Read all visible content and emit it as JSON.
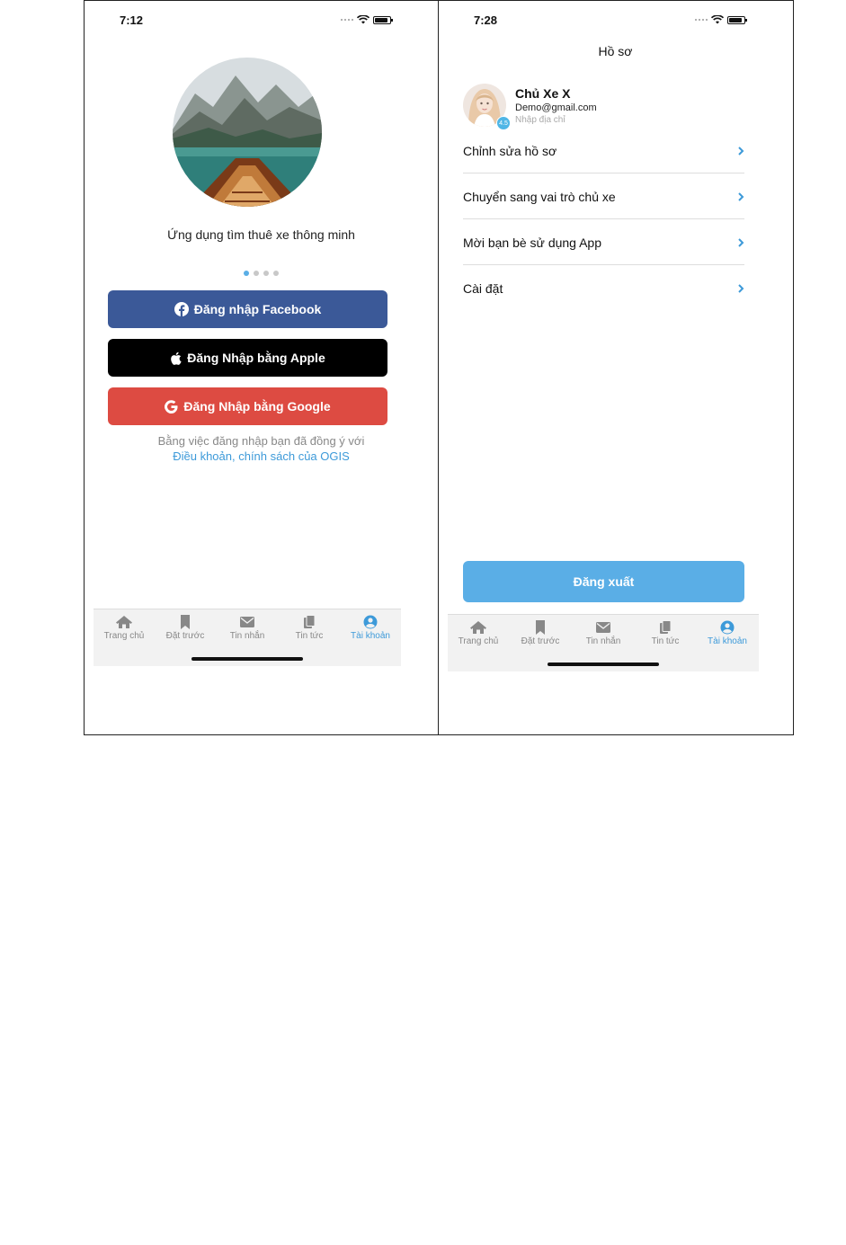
{
  "left_screen": {
    "status_time": "7:12",
    "tagline": "Ứng dụng tìm thuê xe thông minh",
    "buttons": {
      "facebook": "Đăng nhập Facebook",
      "apple": "Đăng Nhập bằng Apple",
      "google": "Đăng Nhập bằng Google"
    },
    "agreement_text": "Bằng việc đăng nhập bạn đã đồng ý với",
    "agreement_link": "Điều khoản, chính sách của OGIS",
    "pager": {
      "pages": 4,
      "active": 1
    },
    "tabs": [
      {
        "label": "Trang chủ",
        "icon": "home-icon"
      },
      {
        "label": "Đặt trước",
        "icon": "bookmark-icon"
      },
      {
        "label": "Tin nhắn",
        "icon": "envelope-icon"
      },
      {
        "label": "Tin tức",
        "icon": "copy-icon"
      },
      {
        "label": "Tài khoản",
        "icon": "user-circle-icon",
        "active": true
      }
    ]
  },
  "right_screen": {
    "status_time": "7:28",
    "title": "Hồ sơ",
    "profile": {
      "name": "Chủ Xe X",
      "email": "Demo@gmail.com",
      "address_placeholder": "Nhập địa chỉ",
      "rating": "4.5"
    },
    "menu": [
      "Chỉnh sửa hồ sơ",
      "Chuyển sang vai trò chủ xe",
      "Mời bạn bè sử dụng App",
      "Cài đặt"
    ],
    "logout": "Đăng xuất",
    "tabs": [
      {
        "label": "Trang chủ",
        "icon": "home-icon"
      },
      {
        "label": "Đặt trước",
        "icon": "bookmark-icon"
      },
      {
        "label": "Tin nhắn",
        "icon": "envelope-icon"
      },
      {
        "label": "Tin tức",
        "icon": "copy-icon"
      },
      {
        "label": "Tài khoản",
        "icon": "user-circle-icon",
        "active": true
      }
    ]
  },
  "colors": {
    "accent": "#5aaee6",
    "link": "#3d9ad9",
    "facebook": "#3b5998",
    "apple": "#000000",
    "google": "#dd4b42"
  }
}
